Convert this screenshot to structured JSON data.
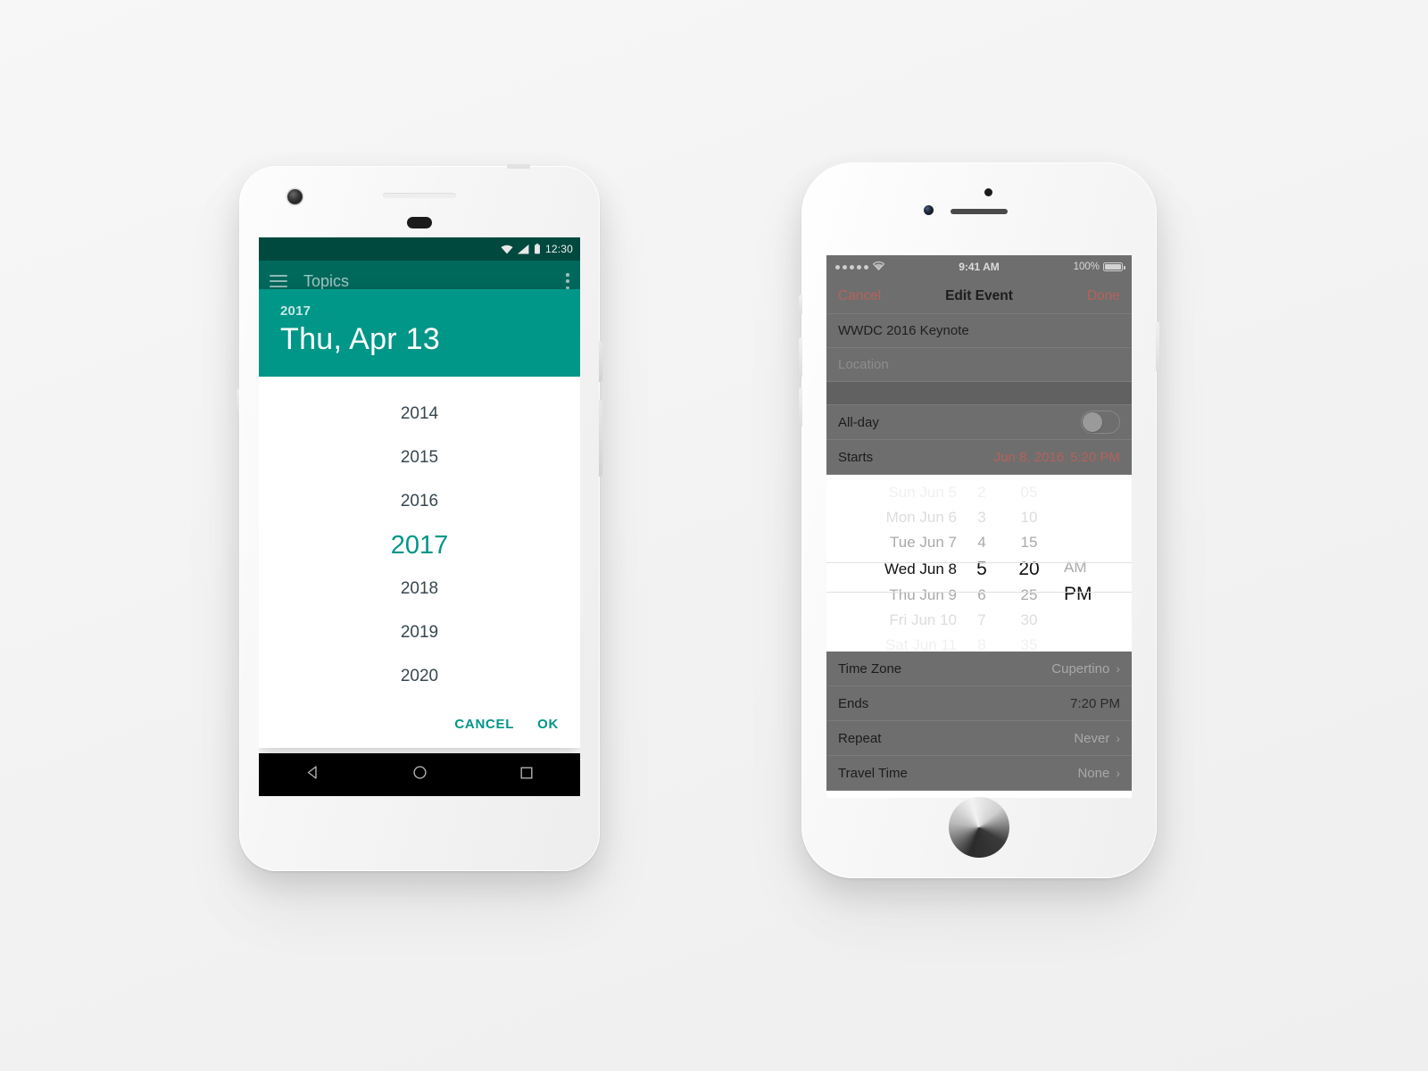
{
  "android": {
    "status_bar": {
      "time": "12:30",
      "icons": [
        "wifi-icon",
        "signal-icon",
        "battery-icon"
      ]
    },
    "app_bar": {
      "menu_icon": "hamburger-menu-icon",
      "title": "Topics",
      "overflow_icon": "overflow-menu-icon"
    },
    "dialog": {
      "header_year": "2017",
      "header_date": "Thu, Apr 13",
      "years": [
        "2014",
        "2015",
        "2016",
        "2017",
        "2018",
        "2019",
        "2020"
      ],
      "selected_year": "2017",
      "cancel_label": "CANCEL",
      "ok_label": "OK",
      "accent_color": "#009688",
      "header_color": "#009688",
      "appbar_color": "#00695c",
      "statusbar_color": "#00493e"
    },
    "nav_bar": {
      "back_icon": "back-triangle-icon",
      "home_icon": "home-circle-icon",
      "recents_icon": "recents-square-icon"
    }
  },
  "ios": {
    "status_bar": {
      "signal": "•••••",
      "wifi_icon": "wifi-icon",
      "time": "9:41 AM",
      "battery_percent": "100%",
      "battery_icon": "battery-icon"
    },
    "nav_bar": {
      "cancel_label": "Cancel",
      "title": "Edit Event",
      "done_label": "Done",
      "accent_color": "#b5625b"
    },
    "fields": {
      "title_value": "WWDC 2016 Keynote",
      "location_placeholder": "Location"
    },
    "rows": [
      {
        "label": "All-day",
        "type": "toggle",
        "value": ""
      },
      {
        "label": "Starts",
        "type": "date",
        "value": "Jun 8, 2016",
        "value2": "5:20 PM"
      }
    ],
    "picker": {
      "dates": [
        "Sun Jun 5",
        "Mon Jun 6",
        "Tue Jun 7",
        "Wed Jun 8",
        "Thu Jun 9",
        "Fri Jun 10",
        "Sat Jun 11"
      ],
      "hours": [
        "2",
        "3",
        "4",
        "5",
        "6",
        "7",
        "8"
      ],
      "minutes": [
        "05",
        "10",
        "15",
        "20",
        "25",
        "30",
        "35"
      ],
      "meridiem": [
        "AM",
        "PM"
      ],
      "selected_date": "Wed Jun 8",
      "selected_hour": "5",
      "selected_minute": "20",
      "selected_meridiem": "PM"
    },
    "bottom_rows": [
      {
        "label": "Time Zone",
        "value": "Cupertino",
        "chevron": true
      },
      {
        "label": "Ends",
        "value": "7:20 PM",
        "chevron": false
      },
      {
        "label": "Repeat",
        "value": "Never",
        "chevron": true
      },
      {
        "label": "Travel Time",
        "value": "None",
        "chevron": true
      }
    ],
    "home_button_icon": "home-button-icon"
  }
}
